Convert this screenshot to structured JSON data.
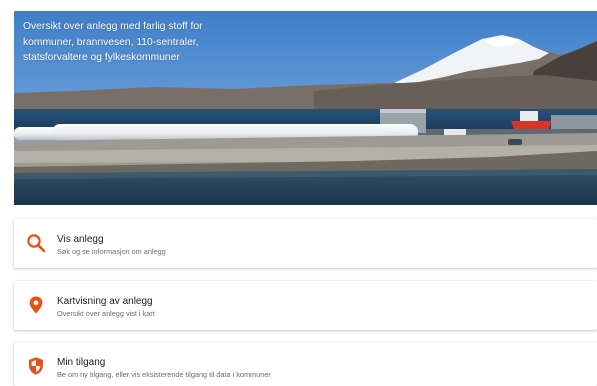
{
  "hero": {
    "text": "Oversikt over anlegg med farlig stoff for kommuner, brannvesen, 110-sentraler, statsforvaltere og fylkeskommuner"
  },
  "accent_color": "#e8510f",
  "cards": [
    {
      "icon": "search-icon",
      "title": "Vis anlegg",
      "subtitle": "Søk og se informasjon om anlegg"
    },
    {
      "icon": "map-pin-icon",
      "title": "Kartvisning av anlegg",
      "subtitle": "Oversikt over anlegg vist i kart"
    },
    {
      "icon": "shield-icon",
      "title": "Min tilgang",
      "subtitle": "Be om ny tilgang, eller vis eksisterende tilgang til data i kommuner"
    }
  ]
}
